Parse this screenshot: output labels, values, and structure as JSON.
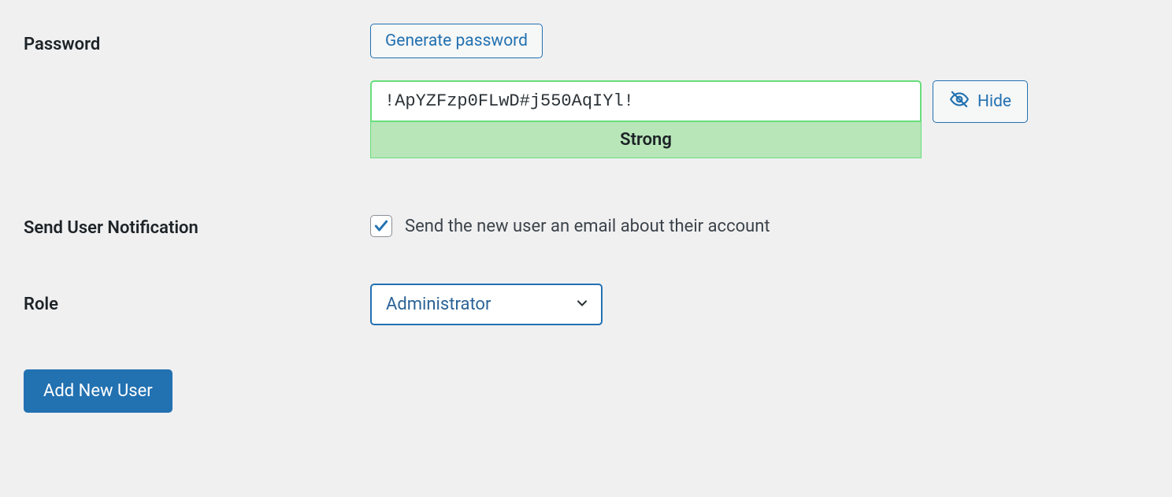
{
  "password": {
    "label": "Password",
    "generate_button": "Generate password",
    "value": "!ApYZFzp0FLwD#j550AqIYl!",
    "strength": "Strong",
    "hide_button": "Hide"
  },
  "notification": {
    "label": "Send User Notification",
    "checkbox_label": "Send the new user an email about their account",
    "checked": true
  },
  "role": {
    "label": "Role",
    "selected": "Administrator"
  },
  "submit": {
    "label": "Add New User"
  }
}
